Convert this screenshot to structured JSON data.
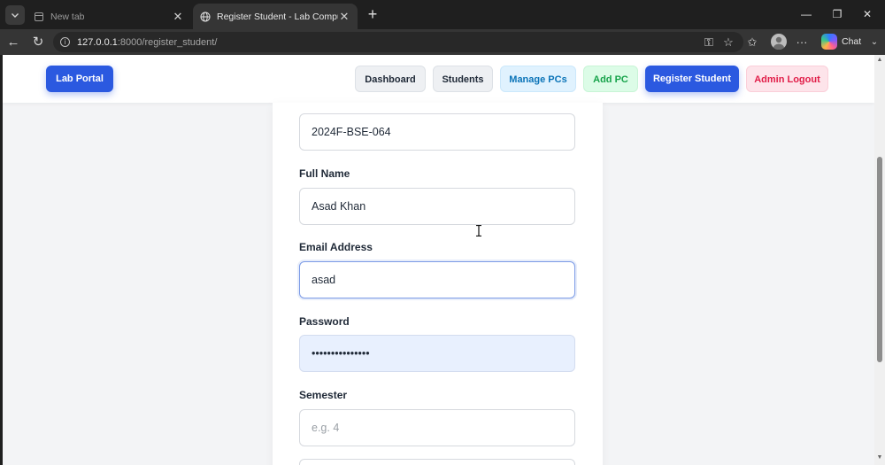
{
  "browser": {
    "tabs": [
      {
        "title": "New tab",
        "active": false
      },
      {
        "title": "Register Student - Lab Computer S",
        "active": true
      }
    ],
    "url": {
      "host": "127.0.0.1",
      "rest": ":8000/register_student/"
    },
    "chat_label": "Chat"
  },
  "header": {
    "brand": "Lab Portal",
    "nav": {
      "dashboard": "Dashboard",
      "students": "Students",
      "manage_pcs": "Manage PCs",
      "add_pc": "Add PC",
      "register_student": "Register Student",
      "admin_logout": "Admin Logout"
    }
  },
  "form": {
    "student_id": {
      "value": "2024F-BSE-064"
    },
    "full_name": {
      "label": "Full Name",
      "value": "Asad Khan"
    },
    "email": {
      "label": "Email Address",
      "value": "asad"
    },
    "password": {
      "label": "Password",
      "masked": "•••••••••••••••"
    },
    "semester": {
      "label": "Semester",
      "placeholder": "e.g. 4"
    }
  },
  "colors": {
    "primary": "#2b59e0",
    "manage_pcs": "#0b74b8",
    "add_pc": "#16a34a",
    "logout": "#e11d48",
    "autofill": "#e8f0fe"
  },
  "icons": [
    "tab-menu-icon",
    "new-tab-page-icon",
    "globe-icon",
    "close-icon",
    "plus-icon",
    "back-icon",
    "reload-icon",
    "info-icon",
    "key-icon",
    "star-icon",
    "favorites-icon",
    "profile-icon",
    "more-icon",
    "copilot-icon"
  ]
}
